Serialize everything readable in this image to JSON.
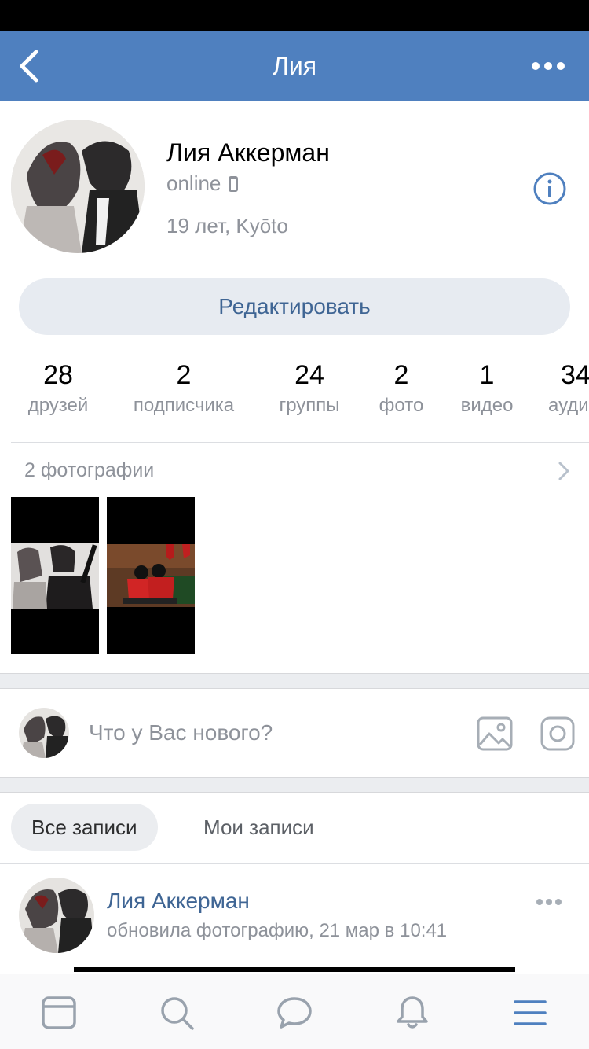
{
  "nav": {
    "title": "Лия",
    "back_icon": "chevron-left-icon",
    "more_icon": "more-horizontal-icon"
  },
  "profile": {
    "name": "Лия Аккерман",
    "status": "online",
    "info": "19 лет, Kyōto",
    "edit_label": "Редактировать"
  },
  "counters": [
    {
      "value": "28",
      "label": "друзей"
    },
    {
      "value": "2",
      "label": "подписчика"
    },
    {
      "value": "24",
      "label": "группы"
    },
    {
      "value": "2",
      "label": "фото"
    },
    {
      "value": "1",
      "label": "видео"
    },
    {
      "value": "34",
      "label": "ауди"
    }
  ],
  "photos": {
    "title": "2 фотографии"
  },
  "composer": {
    "placeholder": "Что у Вас нового?"
  },
  "wall_tabs": {
    "all": "Все записи",
    "mine": "Мои записи"
  },
  "feed": {
    "author": "Лия Аккерман",
    "subtitle": "обновила фотографию, 21 мар в 10:41"
  },
  "colors": {
    "accent": "#4f80bf",
    "link": "#3f6594",
    "muted": "#8e929a"
  }
}
